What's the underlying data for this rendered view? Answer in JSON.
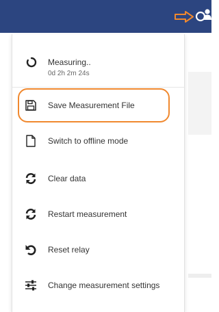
{
  "topbar": {
    "background": "#2c4580",
    "arrow_icon": "right-arrow-icon",
    "status_icon": "spinner-ring-icon",
    "user_icon": "user-icon",
    "annotation_color": "#f0882e"
  },
  "menu": {
    "status": {
      "icon": "spinner-icon",
      "title": "Measuring..",
      "time": "0d 2h 2m 24s"
    },
    "items": [
      {
        "icon": "save-icon",
        "label": "Save Measurement File",
        "highlighted": true
      },
      {
        "icon": "file-icon",
        "label": "Switch to offline mode"
      },
      {
        "icon": "refresh-icon",
        "label": "Clear data"
      },
      {
        "icon": "refresh-icon",
        "label": "Restart measurement"
      },
      {
        "icon": "undo-icon",
        "label": "Reset relay"
      },
      {
        "icon": "sliders-icon",
        "label": "Change measurement settings"
      }
    ]
  }
}
